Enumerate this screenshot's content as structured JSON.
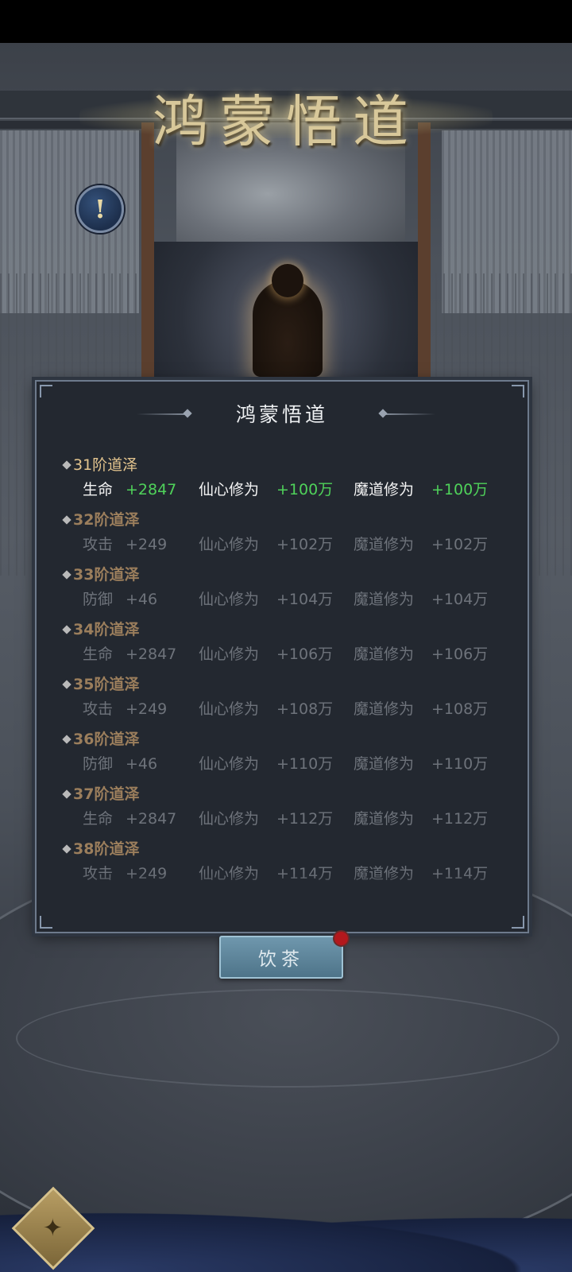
{
  "header": {
    "title": "鸿蒙悟道"
  },
  "panel": {
    "title": "鸿蒙悟道"
  },
  "icons": {
    "info": "info-icon",
    "corner": "menu-diamond-icon",
    "bullet": "diamond-bullet-icon"
  },
  "rows": [
    {
      "level": "31阶道泽",
      "s1k": "生命",
      "s1v": "+2847",
      "s2k": "仙心修为",
      "s2v": "+100万",
      "s3k": "魔道修为",
      "s3v": "+100万",
      "active": true
    },
    {
      "level": "32阶道泽",
      "s1k": "攻击",
      "s1v": "+249",
      "s2k": "仙心修为",
      "s2v": "+102万",
      "s3k": "魔道修为",
      "s3v": "+102万",
      "active": false
    },
    {
      "level": "33阶道泽",
      "s1k": "防御",
      "s1v": "+46",
      "s2k": "仙心修为",
      "s2v": "+104万",
      "s3k": "魔道修为",
      "s3v": "+104万",
      "active": false
    },
    {
      "level": "34阶道泽",
      "s1k": "生命",
      "s1v": "+2847",
      "s2k": "仙心修为",
      "s2v": "+106万",
      "s3k": "魔道修为",
      "s3v": "+106万",
      "active": false
    },
    {
      "level": "35阶道泽",
      "s1k": "攻击",
      "s1v": "+249",
      "s2k": "仙心修为",
      "s2v": "+108万",
      "s3k": "魔道修为",
      "s3v": "+108万",
      "active": false
    },
    {
      "level": "36阶道泽",
      "s1k": "防御",
      "s1v": "+46",
      "s2k": "仙心修为",
      "s2v": "+110万",
      "s3k": "魔道修为",
      "s3v": "+110万",
      "active": false
    },
    {
      "level": "37阶道泽",
      "s1k": "生命",
      "s1v": "+2847",
      "s2k": "仙心修为",
      "s2v": "+112万",
      "s3k": "魔道修为",
      "s3v": "+112万",
      "active": false
    },
    {
      "level": "38阶道泽",
      "s1k": "攻击",
      "s1v": "+249",
      "s2k": "仙心修为",
      "s2v": "+114万",
      "s3k": "魔道修为",
      "s3v": "+114万",
      "active": false
    },
    {
      "level": "39阶道泽",
      "s1k": "",
      "s1v": "",
      "s2k": "",
      "s2v": "",
      "s3k": "",
      "s3v": "",
      "active": false
    }
  ],
  "buttons": {
    "tea": "饮茶"
  },
  "colors": {
    "active_value": "#4fd25a",
    "level_gold": "#e3c48e",
    "level_dim": "#9b7e5c",
    "badge_red": "#b3181d"
  }
}
